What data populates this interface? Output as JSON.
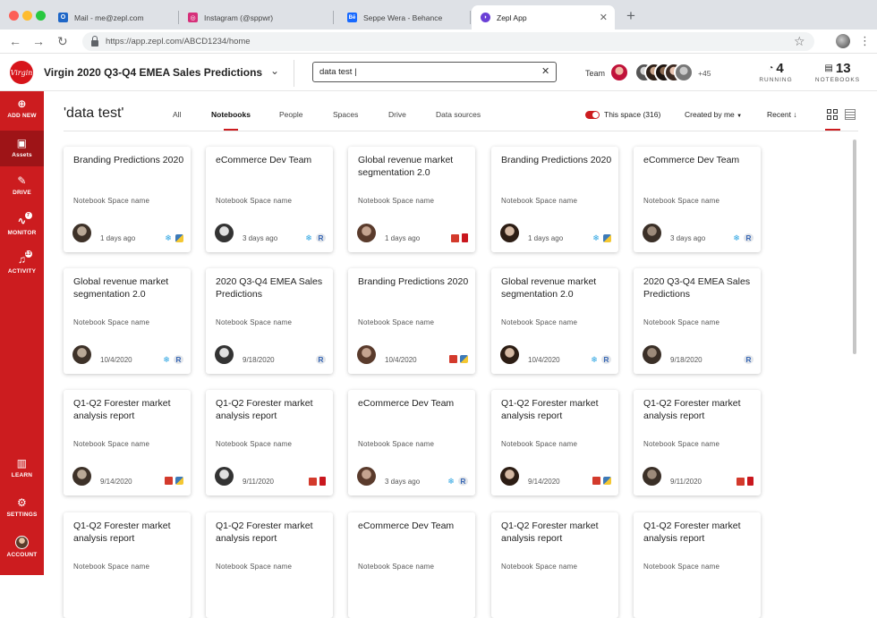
{
  "browser": {
    "tabs": [
      {
        "label": "Mail - me@zepl.com",
        "favicon_color": "#1e66c7",
        "favicon_glyph": "O",
        "active": false
      },
      {
        "label": "Instagram (@sppwr)",
        "favicon_color": "#d6307a",
        "favicon_glyph": "◎",
        "active": false
      },
      {
        "label": "Seppe Wera - Behance",
        "favicon_color": "#1769ff",
        "favicon_glyph": "Bē",
        "active": false
      },
      {
        "label": "Zepl App",
        "favicon_color": "#6a3fd6",
        "favicon_glyph": "◗",
        "active": true
      }
    ],
    "url": "https://app.zepl.com/ABCD1234/home"
  },
  "header": {
    "project_title": "Virgin 2020 Q3-Q4 EMEA Sales Predictions",
    "logo_text": "Virgin",
    "search_value": "data test |",
    "team_label": "Team",
    "team_more": "+45",
    "running_count": "4",
    "running_label": "RUNNING",
    "notebooks_count": "13",
    "notebooks_label": "NOTEBOOKS"
  },
  "sidebar": {
    "top": [
      {
        "label": "ADD NEW",
        "icon": "plus-circle-icon",
        "glyph": "⊕"
      },
      {
        "label": "Assets",
        "icon": "briefcase-icon",
        "glyph": "▣",
        "active": true
      },
      {
        "label": "DRIVE",
        "icon": "paperclip-icon",
        "glyph": "✎"
      },
      {
        "label": "MONITOR",
        "icon": "pulse-icon",
        "glyph": "∿",
        "badge": "7"
      },
      {
        "label": "ACTIVITY",
        "icon": "bell-icon",
        "glyph": "♫",
        "badge": "13"
      }
    ],
    "bottom": [
      {
        "label": "LEARN",
        "icon": "book-icon",
        "glyph": "▥"
      },
      {
        "label": "SETTINGS",
        "icon": "gear-icon",
        "glyph": "⚙"
      },
      {
        "label": "ACCOUNT",
        "icon": "account-avatar"
      }
    ]
  },
  "filters": {
    "query_title": "'data test'",
    "tabs": [
      "All",
      "Notebooks",
      "People",
      "Spaces",
      "Drive",
      "Data sources"
    ],
    "active_tab": "Notebooks",
    "toggle_label": "This space (316)",
    "created_by": "Created by me",
    "sort": "Recent"
  },
  "cards": [
    {
      "title": "Branding Predictions 2020",
      "space": "Notebook Space name",
      "date": "1 days ago",
      "icons": [
        "snowflake",
        "python"
      ]
    },
    {
      "title": "eCommerce Dev Team",
      "space": "Notebook Space name",
      "date": "3 days ago",
      "icons": [
        "snowflake",
        "r"
      ]
    },
    {
      "title": "Global revenue market segmentation 2.0",
      "space": "Notebook Space name",
      "date": "1 days ago",
      "icons": [
        "databricks",
        "square"
      ]
    },
    {
      "title": "Branding Predictions 2020",
      "space": "Notebook Space name",
      "date": "1 days ago",
      "icons": [
        "snowflake",
        "python"
      ]
    },
    {
      "title": "eCommerce Dev Team",
      "space": "Notebook Space name",
      "date": "3 days ago",
      "icons": [
        "snowflake",
        "r"
      ]
    },
    {
      "title": "Global revenue market segmentation 2.0",
      "space": "Notebook Space name",
      "date": "10/4/2020",
      "icons": [
        "snowflake",
        "r"
      ]
    },
    {
      "title": "2020 Q3-Q4 EMEA Sales Predictions",
      "space": "Notebook Space name",
      "date": "9/18/2020",
      "icons": [
        "r"
      ]
    },
    {
      "title": "Branding Predictions 2020",
      "space": "Notebook Space name",
      "date": "10/4/2020",
      "icons": [
        "databricks",
        "python"
      ]
    },
    {
      "title": "Global revenue market segmentation 2.0",
      "space": "Notebook Space name",
      "date": "10/4/2020",
      "icons": [
        "snowflake",
        "r"
      ]
    },
    {
      "title": "2020 Q3-Q4 EMEA Sales Predictions",
      "space": "Notebook Space name",
      "date": "9/18/2020",
      "icons": [
        "r"
      ]
    },
    {
      "title": "Q1-Q2 Forester market analysis report",
      "space": "Notebook Space name",
      "date": "9/14/2020",
      "icons": [
        "databricks",
        "python"
      ]
    },
    {
      "title": "Q1-Q2 Forester market analysis report",
      "space": "Notebook Space name",
      "date": "9/11/2020",
      "icons": [
        "databricks",
        "square"
      ]
    },
    {
      "title": "eCommerce Dev Team",
      "space": "Notebook Space name",
      "date": "3 days ago",
      "icons": [
        "snowflake",
        "r"
      ]
    },
    {
      "title": "Q1-Q2 Forester market analysis report",
      "space": "Notebook Space name",
      "date": "9/14/2020",
      "icons": [
        "databricks",
        "python"
      ]
    },
    {
      "title": "Q1-Q2 Forester market analysis report",
      "space": "Notebook Space name",
      "date": "9/11/2020",
      "icons": [
        "databricks",
        "square"
      ]
    },
    {
      "title": "Q1-Q2 Forester market analysis report",
      "space": "Notebook Space name",
      "date": "",
      "icons": []
    },
    {
      "title": "Q1-Q2 Forester market analysis report",
      "space": "Notebook Space name",
      "date": "",
      "icons": []
    },
    {
      "title": "eCommerce Dev Team",
      "space": "Notebook Space name",
      "date": "",
      "icons": []
    },
    {
      "title": "Q1-Q2 Forester market analysis report",
      "space": "Notebook Space name",
      "date": "",
      "icons": []
    },
    {
      "title": "Q1-Q2 Forester market analysis report",
      "space": "Notebook Space name",
      "date": "",
      "icons": []
    }
  ],
  "colors": {
    "brand": "#cc1c1f",
    "brand_dark": "#9e1417"
  }
}
